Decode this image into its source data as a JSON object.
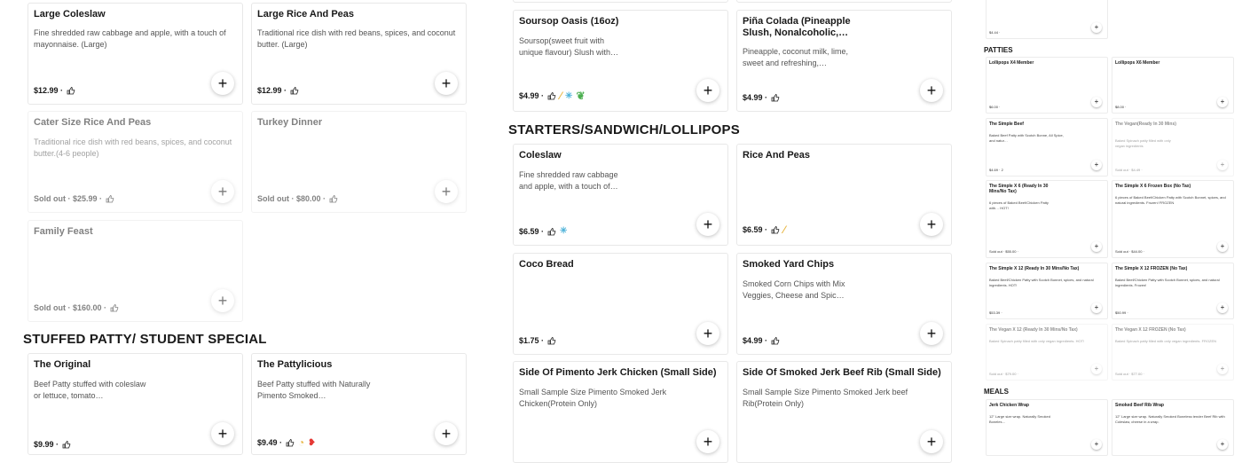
{
  "sections": {
    "stuffed": "STUFFED PATTY/ STUDENT SPECIAL",
    "starters": "STARTERS/SANDWICH/LOLLIPOPS",
    "patties": "PATTIES",
    "meals": "MEALS"
  },
  "col1": [
    {
      "name": "Large Coleslaw",
      "desc": "Fine shredded raw cabbage and apple, with a touch of mayonnaise. (Large)",
      "foot": "$12.99 ·"
    },
    {
      "name": "Cater Size Rice And Peas",
      "desc": "Traditional rice dish with red beans, spices, and coconut butter.(4-6 people)",
      "foot": "Sold out · $25.99 ·"
    },
    {
      "name": "Family Feast",
      "desc": "",
      "foot": "Sold out · $160.00 ·"
    },
    {
      "name": "The Original",
      "desc": "Beef Patty stuffed with coleslaw or lettuce, tomato…",
      "foot": "$9.99 ·"
    }
  ],
  "col2": [
    {
      "name": "Large Rice And Peas",
      "desc": "Traditional rice dish with red beans, spices, and coconut butter. (Large)",
      "foot": "$12.99 ·"
    },
    {
      "name": "Turkey Dinner",
      "desc": "",
      "foot": "Sold out · $80.00 ·"
    },
    {
      "name": "The Pattylicious",
      "desc": "Beef Patty stuffed with Naturally Pimento Smoked…",
      "foot": "$9.49 ·"
    }
  ],
  "col3": [
    {
      "name": "Soursop Oasis (16oz)",
      "desc": "Soursop(sweet fruit with unique flavour) Slush with…",
      "foot": "$4.99 ·"
    },
    {
      "name": "Coleslaw",
      "desc": "Fine shredded raw cabbage and apple, with a touch of…",
      "foot": "$6.59 ·"
    },
    {
      "name": "Coco Bread",
      "desc": "",
      "foot": "$1.75 ·"
    },
    {
      "name": "Side Of Pimento Jerk Chicken (Small Side)",
      "desc": "Small Sample Size Pimento Smoked Jerk Chicken(Protein Only)",
      "foot": ""
    }
  ],
  "col4": [
    {
      "name": "Piña Colada (Pineapple Slush, Nonalcoholic,…",
      "desc": "Pineapple, coconut milk, lime, sweet and refreshing,…",
      "foot": "$4.99 ·"
    },
    {
      "name": "Rice And Peas",
      "desc": "",
      "foot": "$6.59 ·"
    },
    {
      "name": "Smoked Yard Chips",
      "desc": "Smoked Corn Chips with Mix Veggies, Cheese and Spic…",
      "foot": "$4.99 ·"
    },
    {
      "name": "Side Of Smoked Jerk Beef Rib (Small Side)",
      "desc": "Small Sample Size Pimento Smoked Jerk beef Rib(Protein Only)",
      "foot": ""
    }
  ],
  "mini": {
    "top_foot": "$4.44 ·",
    "items": [
      {
        "name": "Lollipops X4 Member",
        "desc": "",
        "foot": "$6.00 ·"
      },
      {
        "name": "Lollipops X6 Member",
        "desc": "",
        "foot": "$8.00 ·"
      },
      {
        "name": "The Simple Beef",
        "desc": "Baked Beef Patty with Scotch Bonne, All Spice, and natur…",
        "foot": "$4.69 · 2"
      },
      {
        "name": "The Vegan(Ready In 30 Mins)",
        "desc": "Baked Spinach patty filled with only vegan ingredients",
        "foot": "Sold out · $4.49 ·"
      },
      {
        "name": "The Simple X 6 (Ready In 30 Mins/No Tax)",
        "desc": "6 pieces of Baked Beef/Chicken Patty with… HOT!",
        "foot": "Sold out · $55.00 ·"
      },
      {
        "name": "The Simple X 6 Frozen Box (No Tax)",
        "desc": "6 pieces of Baked Beef/Chicken Patty with Scotch Bonnet, spices, and natural ingredients. Frozen! FROZEN",
        "foot": "Sold out · $44.00 ·"
      },
      {
        "name": "The Simple X 12 (Ready In 30 Mins/No Tax)",
        "desc": "Baked Beef/Chicken Patty with Scotch Bonnet, spices, and natural ingredients. HOT!",
        "foot": "$53.39 ·"
      },
      {
        "name": "The Simple X 12 FROZEN (No Tax)",
        "desc": "Baked Beef/Chicken Patty with Scotch Bonnet, spices, and natural ingredients. Frozen!",
        "foot": "$50.99 ·"
      },
      {
        "name": "The Vegan X 12 (Ready In 30 Mins/No Tax)",
        "desc": "Baked Spinach patty filled with only vegan ingredients. HOT!",
        "foot": "Sold out · $79.00 ·"
      },
      {
        "name": "The Vegan X 12 FROZEN (No Tax)",
        "desc": "Baked Spinach patty filled with only vegan ingredients. FROZEN",
        "foot": "Sold out · $77.00 ·"
      },
      {
        "name": "Jerk Chicken Wrap",
        "desc": "12\" Large size wrap. Naturally Smoked Boneles…",
        "foot": ""
      },
      {
        "name": "Smoked Beef Rib Wrap",
        "desc": "12\" Large size wrap. Naturally Smoked Boneless tender Beef Rib with Coleslaw, cheese in a wrap.",
        "foot": ""
      }
    ]
  },
  "plus_label": "+",
  "colors": {
    "text": "#191919",
    "muted": "#545454",
    "border": "#e8e8e8"
  }
}
